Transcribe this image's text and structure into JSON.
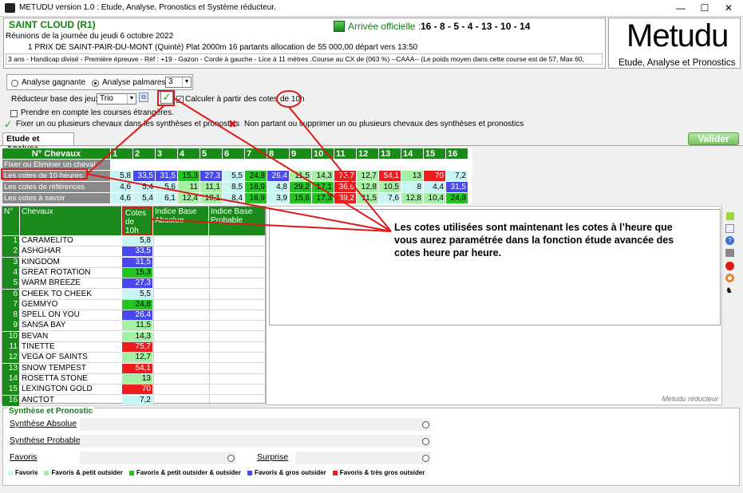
{
  "window": {
    "title": "METUDU version 1.0  : Etude, Analyse,  Pronostics et Système réducteur.",
    "minimize": "—",
    "maximize": "☐",
    "close": "✕"
  },
  "header": {
    "course": "SAINT CLOUD (R1)",
    "reunions": "Réunions de la journée du jeudi 6 octobre 2022",
    "prix": "1 PRIX DE SAINT-PAIR-DU-MONT (Quinté) Plat 2000m 16 partants allocation de 55 000,00 départ vers 13:50",
    "conditions": "3 ans - Handicap divisé - Première épreuve - Réf : +19 - Gazon - Corde à gauche - Lice à 11 mètres .Course au CX de (063 %)  --CAAA--  (Le poids moyen dans cette course est de 57, Max 60,",
    "arrivee_label": "Arrivée officielle :",
    "arrivee": "16 - 8 - 5 - 4 - 13 - 10 - 14"
  },
  "logo": {
    "title": "Metudu",
    "subtitle": "Etude, Analyse et Pronostics"
  },
  "options": {
    "analyse_gagnante": "Analyse gagnante",
    "analyse_palmares": "Analyse palmares",
    "palmares_value": "3",
    "reducteur_label": "Réducteur base des jeux :",
    "reducteur_value": "Trio",
    "calculer_label": "Calculer à partir des cotes de",
    "calculer_value": "10h",
    "etrangeres": "Prendre en compte les courses étrangères.",
    "fixer": "Fixer un ou plusieurs chevaux dans les synthèses et pronostics",
    "non_partant": "Non partant ou supprimer un ou plusieurs chevaux des synthèses et pronostics"
  },
  "tab": {
    "label": "Etude et Analyse"
  },
  "valider": "Valider",
  "grid": {
    "header_label": "N° Chevaux",
    "numbers": [
      "1",
      "2",
      "3",
      "4",
      "5",
      "6",
      "7",
      "8",
      "9",
      "10",
      "11",
      "12",
      "13",
      "14",
      "15",
      "16"
    ],
    "rows": [
      {
        "label": "Fixer ou Eliminer un cheval",
        "values": [
          "",
          "",
          "",
          "",
          "",
          "",
          "",
          "",
          "",
          "",
          "",
          "",
          "",
          "",
          "",
          ""
        ],
        "colors": [
          "",
          "",
          "",
          "",
          "",
          "",
          "",
          "",
          "",
          "",
          "",
          "",
          "",
          "",
          "",
          ""
        ]
      },
      {
        "label": "Les cotes de 10 heures",
        "values": [
          "5,8",
          "33,5",
          "31,5",
          "15,3",
          "27,3",
          "5,5",
          "24,8",
          "26,4",
          "11,5",
          "14,3",
          "75,7",
          "12,7",
          "54,1",
          "13",
          "70",
          "7,2"
        ],
        "colors": [
          "#c8f4f4",
          "#4848f0",
          "#4848f0",
          "#22c422",
          "#4848f0",
          "#c8f4f4",
          "#22c422",
          "#4848f0",
          "#a6f0a6",
          "#a6f0a6",
          "#ee1c1c",
          "#a6f0a6",
          "#ee1c1c",
          "#a6f0a6",
          "#ee1c1c",
          "#c8f4f4"
        ]
      },
      {
        "label": "Les cotes de références",
        "values": [
          "4,6",
          "5,4",
          "5,6",
          "11",
          "11,1",
          "8,5",
          "16,9",
          "4,8",
          "29,2",
          "17,1",
          "36,6",
          "12,8",
          "10,5",
          "8",
          "4,4",
          "31,5"
        ],
        "colors": [
          "#c8f4f4",
          "#c8f4f4",
          "#c8f4f4",
          "#a6f0a6",
          "#a6f0a6",
          "#c8f4f4",
          "#22c422",
          "#c8f4f4",
          "#22c422",
          "#22c422",
          "#ee1c1c",
          "#a6f0a6",
          "#a6f0a6",
          "#c8f4f4",
          "#c8f4f4",
          "#4848f0"
        ]
      },
      {
        "label": "Les cotes à savoir",
        "values": [
          "4,6",
          "5,4",
          "6,1",
          "12,4",
          "10,1",
          "8,4",
          "16,9",
          "3,9",
          "15,6",
          "17,3",
          "39,2",
          "11,5",
          "7,6",
          "12,8",
          "10,4",
          "24,8"
        ],
        "colors": [
          "#c8f4f4",
          "#c8f4f4",
          "#c8f4f4",
          "#a6f0a6",
          "#a6f0a6",
          "#c8f4f4",
          "#22c422",
          "#c8f4f4",
          "#22c422",
          "#22c422",
          "#ee1c1c",
          "#a6f0a6",
          "#c8f4f4",
          "#a6f0a6",
          "#a6f0a6",
          "#22c422"
        ]
      }
    ]
  },
  "horse_table": {
    "col_num": "N°",
    "col_name": "Chevaux",
    "col_cotes": "Cotes de 10h",
    "col_absolue": "Indice Base Absolue",
    "col_probable": "Indice Base Probable",
    "horses": [
      {
        "num": "1",
        "name": "CARAMELITO",
        "cote": "5,8",
        "color": "#c8f4f4"
      },
      {
        "num": "2",
        "name": "ASHGHAR",
        "cote": "33,5",
        "color": "#4848f0"
      },
      {
        "num": "3",
        "name": "KINGDOM",
        "cote": "31,5",
        "color": "#4848f0"
      },
      {
        "num": "4",
        "name": "GREAT ROTATION",
        "cote": "15,3",
        "color": "#22c422"
      },
      {
        "num": "5",
        "name": "WARM BREEZE",
        "cote": "27,3",
        "color": "#4848f0"
      },
      {
        "num": "6",
        "name": "CHEEK TO CHEEK",
        "cote": "5,5",
        "color": "#c8f4f4"
      },
      {
        "num": "7",
        "name": "GEMMYO",
        "cote": "24,8",
        "color": "#22c422"
      },
      {
        "num": "8",
        "name": "SPELL ON YOU",
        "cote": "26,4",
        "color": "#4848f0"
      },
      {
        "num": "9",
        "name": "SANSA BAY",
        "cote": "11,5",
        "color": "#a6f0a6"
      },
      {
        "num": "10",
        "name": "BEVAN",
        "cote": "14,3",
        "color": "#a6f0a6"
      },
      {
        "num": "11",
        "name": "TINETTE",
        "cote": "75,7",
        "color": "#ee1c1c"
      },
      {
        "num": "12",
        "name": "VEGA OF SAINTS",
        "cote": "12,7",
        "color": "#a6f0a6"
      },
      {
        "num": "13",
        "name": "SNOW TEMPEST",
        "cote": "54,1",
        "color": "#ee1c1c"
      },
      {
        "num": "14",
        "name": "ROSETTA STONE",
        "cote": "13",
        "color": "#a6f0a6"
      },
      {
        "num": "15",
        "name": "LEXINGTON GOLD",
        "cote": "70",
        "color": "#ee1c1c"
      },
      {
        "num": "16",
        "name": "ANCTOT",
        "cote": "7,2",
        "color": "#c8f4f4"
      }
    ]
  },
  "annotation": "Les cotes utilisées sont maintenant les cotes à l’heure que vous aurez paramétrée dans la fonction étude avancée des cotes heure par heure.",
  "reducteur_footer": "Metudu réducteur",
  "synthese": {
    "title": "Synthèse et Pronostic",
    "absolue": "Synthèse Absolue",
    "probable": "Synthèse Probable",
    "favoris": "Favoris",
    "surprise": "Surprise"
  },
  "legend": [
    {
      "label": "Favoris",
      "color": "#c8f4f4"
    },
    {
      "label": "Favoris & petit outsider",
      "color": "#a6f0a6"
    },
    {
      "label": "Favoris & petit outsider & outsider",
      "color": "#22c422"
    },
    {
      "label": "Favoris & gros outsider",
      "color": "#4848f0"
    },
    {
      "label": "Favoris & très gros outsider",
      "color": "#ee1c1c"
    }
  ]
}
